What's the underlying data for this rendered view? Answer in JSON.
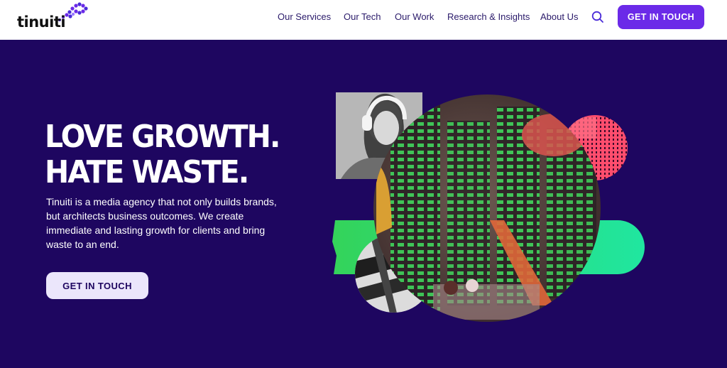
{
  "header": {
    "logo_text": "tinuiti",
    "nav": [
      {
        "label": "Our Services"
      },
      {
        "label": "Our Tech"
      },
      {
        "label": "Our Work"
      },
      {
        "label": "Research & Insights"
      },
      {
        "label": "About Us"
      }
    ],
    "cta_label": "GET IN TOUCH"
  },
  "hero": {
    "title_line1": "LOVE GROWTH.",
    "title_line2": "HATE WASTE.",
    "description": "Tinuiti is a media agency that not only builds brands, but architects business outcomes. We create immediate and lasting growth for clients and bring waste to an end.",
    "cta_label": "GET IN TOUCH"
  },
  "colors": {
    "background": "#1e0660",
    "accent": "#6b2ae8",
    "nav_text": "#2a1a6a",
    "pink_circle": "#ff4d6d",
    "green_pill": "#2ee86a"
  },
  "icons": {
    "search": "search-icon",
    "logo_mark": "logo-dots-mark"
  }
}
